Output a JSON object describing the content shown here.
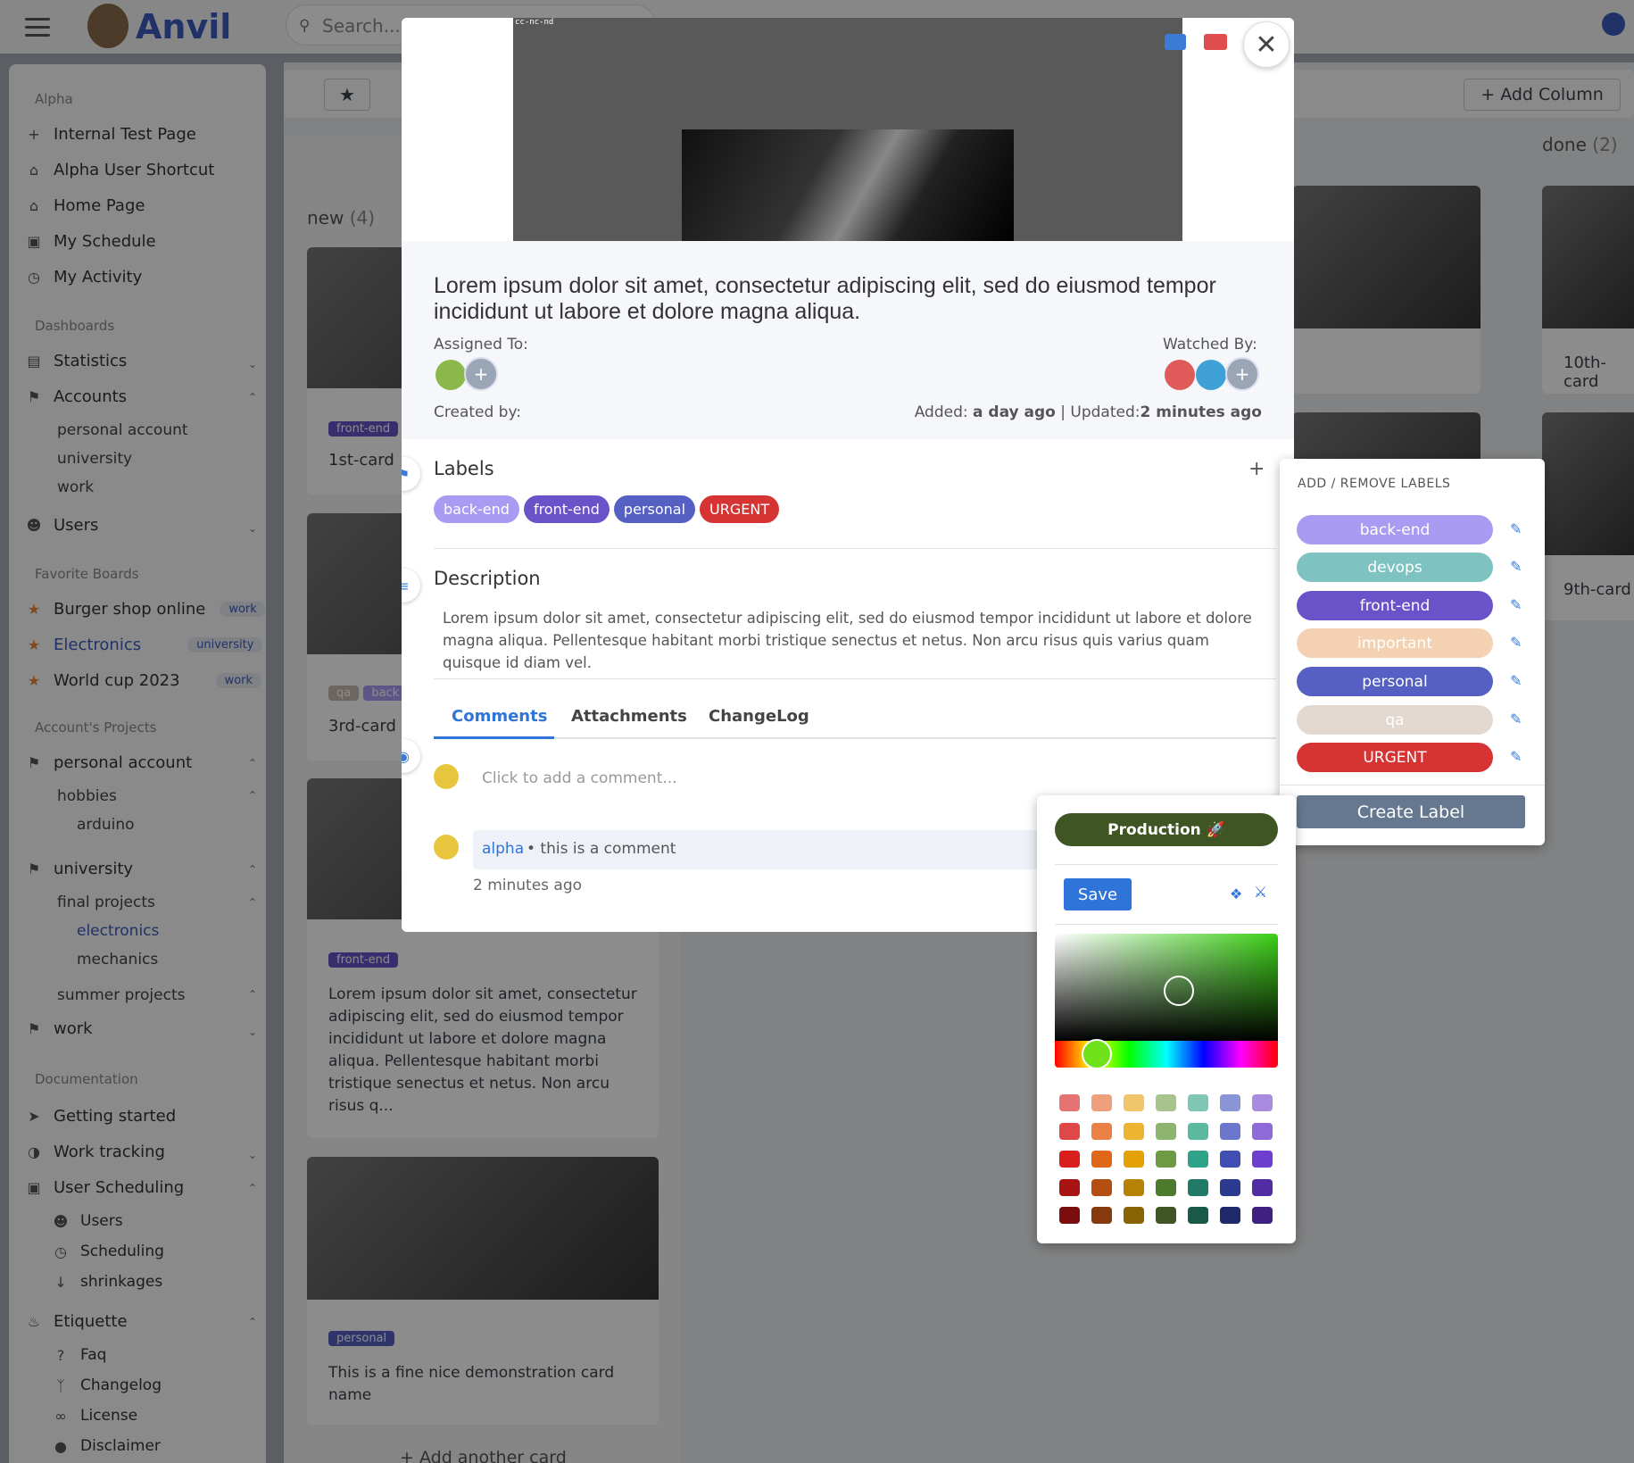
{
  "app": {
    "name": "Anvil",
    "search_placeholder": "Search..."
  },
  "sidebar": {
    "alpha_section": "Alpha",
    "alpha_items": [
      "Internal Test Page",
      "Alpha User Shortcut",
      "Home Page",
      "My Schedule",
      "My Activity"
    ],
    "dashboards_section": "Dashboards",
    "statistics": "Statistics",
    "accounts": "Accounts",
    "accounts_sub": [
      "personal account",
      "university",
      "work"
    ],
    "users": "Users",
    "favorites_section": "Favorite Boards",
    "favorites": [
      {
        "name": "Burger shop online",
        "tag": "work"
      },
      {
        "name": "Electronics",
        "tag": "university"
      },
      {
        "name": "World cup 2023",
        "tag": "work"
      }
    ],
    "projects_section": "Account's Projects",
    "proj_personal": "personal account",
    "proj_hobbies": "hobbies",
    "proj_arduino": "arduino",
    "proj_university": "university",
    "proj_final": "final projects",
    "proj_electronics": "electronics",
    "proj_mechanics": "mechanics",
    "proj_summer": "summer projects",
    "proj_work": "work",
    "docs_section": "Documentation",
    "getting_started": "Getting started",
    "work_tracking": "Work tracking",
    "user_scheduling": "User Scheduling",
    "sched_users": "Users",
    "sched_scheduling": "Scheduling",
    "sched_shrinkages": "shrinkages",
    "etiquette": "Etiquette",
    "faq": "Faq",
    "changelog": "Changelog",
    "license": "License",
    "disclaimer": "Disclaimer"
  },
  "board": {
    "add_column": "Add Column",
    "col_new": {
      "name": "new",
      "count": "(4)"
    },
    "col_done": {
      "name": "done",
      "count": "(2)"
    },
    "cards": {
      "c1_label": "front-end",
      "c1_title": "1st-card",
      "c2_label1": "qa",
      "c2_label2": "back",
      "c2_title": "3rd-card",
      "c3_label": "front-end",
      "c3_text": "Lorem ipsum dolor sit amet, consectetur adipiscing elit, sed do eiusmod tempor incididunt ut labore et dolore magna aliqua. Pellentesque habitant morbi tristique senectus et netus. Non arcu risus q...",
      "c4_label": "personal",
      "c4_title": "This is a fine nice demonstration card name",
      "c10": "10th-card",
      "c9": "9th-card"
    },
    "add_card": "Add another card"
  },
  "modal": {
    "video_caption": "cc-nc-nd",
    "title": "Lorem ipsum dolor sit amet, consectetur adipiscing elit, sed do eiusmod tempor incididunt ut labore et dolore magna aliqua.",
    "assigned_to": "Assigned To:",
    "watched_by": "Watched By:",
    "created_by": "Created by:",
    "added_label": "Added:",
    "added_value": "a day ago",
    "updated_label": "Updated:",
    "updated_value": "2 minutes ago",
    "labels_title": "Labels",
    "labels": [
      {
        "name": "back-end",
        "color": "#a99bf2"
      },
      {
        "name": "front-end",
        "color": "#6a52c8"
      },
      {
        "name": "personal",
        "color": "#5560c2"
      },
      {
        "name": "URGENT",
        "color": "#d63333"
      }
    ],
    "description_title": "Description",
    "description": "Lorem ipsum dolor sit amet, consectetur adipiscing elit, sed do eiusmod tempor incididunt ut labore et dolore magna aliqua. Pellentesque habitant morbi tristique senectus et netus. Non arcu risus quis varius quam quisque id diam vel.",
    "tabs": [
      "Comments",
      "Attachments",
      "ChangeLog"
    ],
    "comment_placeholder": "Click to add a comment...",
    "comment_author": "alpha",
    "comment_text": "• this is a comment",
    "comment_time": "2 minutes ago"
  },
  "label_popover": {
    "title": "ADD / REMOVE LABELS",
    "labels": [
      {
        "name": "back-end",
        "color": "#a99bf2"
      },
      {
        "name": "devops",
        "color": "#7ec3c2"
      },
      {
        "name": "front-end",
        "color": "#6a52c8"
      },
      {
        "name": "important",
        "color": "#f3d1b2"
      },
      {
        "name": "personal",
        "color": "#5560c2"
      },
      {
        "name": "qa",
        "color": "#e2d8d0"
      },
      {
        "name": "URGENT",
        "color": "#d63333"
      }
    ],
    "create_label": "Create Label"
  },
  "color_picker": {
    "label_name": "Production 🚀",
    "label_color": "#3f5524",
    "save": "Save",
    "swatches": [
      [
        "#e57373",
        "#ee9f7c",
        "#f1c66b",
        "#a8c48c",
        "#7fc7b4",
        "#8a95d6",
        "#a98ce0"
      ],
      [
        "#e04848",
        "#ec8148",
        "#eeb431",
        "#8db56d",
        "#5bb9a0",
        "#6a77cc",
        "#8d6ad8"
      ],
      [
        "#d91e1e",
        "#e0661a",
        "#e4a106",
        "#6e9a44",
        "#2fa38a",
        "#3f4fb4",
        "#6e3fce"
      ],
      [
        "#a81414",
        "#b34d12",
        "#b58205",
        "#4e7a2e",
        "#217a67",
        "#2b3990",
        "#522ca2"
      ],
      [
        "#7a0e0e",
        "#873a0d",
        "#8a6304",
        "#3f5524",
        "#195948",
        "#1e2a6b",
        "#3e2180"
      ]
    ]
  }
}
